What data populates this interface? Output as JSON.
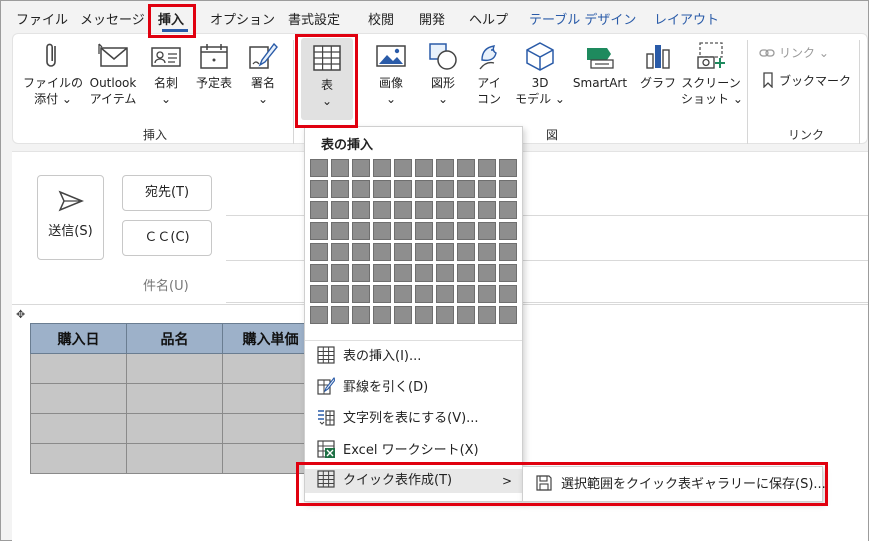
{
  "tabs": [
    {
      "label": "ファイル"
    },
    {
      "label": "メッセージ"
    },
    {
      "label": "挿入"
    },
    {
      "label": "オプション"
    },
    {
      "label": "書式設定"
    },
    {
      "label": "校閲"
    },
    {
      "label": "開発"
    },
    {
      "label": "ヘルプ"
    },
    {
      "label": "テーブル デザイン"
    },
    {
      "label": "レイアウト"
    }
  ],
  "ribbon": {
    "attach_file": {
      "line1": "ファイルの",
      "line2": "添付 ⌄"
    },
    "outlook_item": {
      "line1": "Outlook",
      "line2": "アイテム"
    },
    "business_card": {
      "line1": "名刺",
      "line2": "⌄"
    },
    "schedule": {
      "line1": "予定表"
    },
    "signature": {
      "line1": "署名",
      "line2": "⌄"
    },
    "table": {
      "line1": "表",
      "line2": "⌄"
    },
    "image": {
      "line1": "画像",
      "line2": "⌄"
    },
    "shapes": {
      "line1": "図形",
      "line2": "⌄"
    },
    "icons": {
      "line1": "アイ",
      "line2": "コン"
    },
    "models3d": {
      "line1": "3D",
      "line2": "モデル ⌄"
    },
    "smartart": {
      "line1": "SmartArt"
    },
    "chart": {
      "line1": "グラフ"
    },
    "screenshot": {
      "line1": "スクリーン",
      "line2": "ショット ⌄"
    },
    "link": {
      "label": "リンク ⌄"
    },
    "bookmark": {
      "label": "ブックマーク"
    },
    "groups": {
      "insert": "挿入",
      "figure": "図",
      "links": "リンク"
    }
  },
  "compose": {
    "send": "送信(S)",
    "to": "宛先(T)",
    "cc": "ＣＣ(C)",
    "subject": "件名(U)"
  },
  "email_table": {
    "headers": [
      "購入日",
      "品名",
      "購入単価"
    ],
    "rows": 4
  },
  "dropdown": {
    "title": "表の挿入",
    "grid": {
      "cols": 10,
      "rows": 8
    },
    "items": [
      {
        "label": "表の挿入(I)..."
      },
      {
        "label": "罫線を引く(D)"
      },
      {
        "label": "文字列を表にする(V)..."
      },
      {
        "label": "Excel ワークシート(X)"
      },
      {
        "label": "クイック表作成(T)"
      }
    ],
    "submenu_item": "選択範囲をクイック表ギャラリーに保存(S)..."
  },
  "colors": {
    "accent": "#2a5ba8",
    "highlight": "#e0000f",
    "table_header": "#9db1c9"
  }
}
